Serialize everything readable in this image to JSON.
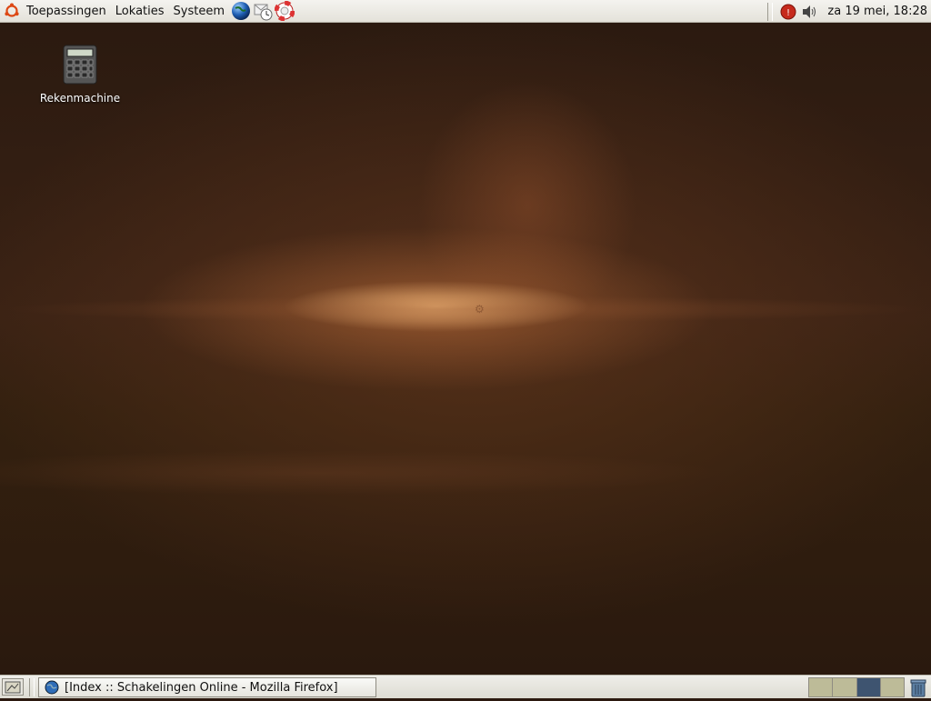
{
  "top_panel": {
    "menus": [
      {
        "label": "Toepassingen"
      },
      {
        "label": "Lokaties"
      },
      {
        "label": "Systeem"
      }
    ],
    "launchers": [
      "firefox-icon",
      "mail-clock-icon",
      "help-lifebuoy-icon"
    ],
    "tray": {
      "icons": [
        "update-notifier-icon",
        "volume-icon"
      ],
      "clock": "za 19 mei, 18:28"
    }
  },
  "desktop": {
    "icons": [
      {
        "label": "Rekenmachine",
        "icon": "calculator-icon"
      }
    ]
  },
  "bottom_panel": {
    "tasks": [
      {
        "label": "[Index :: Schakelingen Online - Mozilla Firefox]",
        "icon": "firefox-icon"
      }
    ],
    "workspaces": 4,
    "active_workspace": 3
  },
  "colors": {
    "panel": "#e9e7e0",
    "desktop_base": "#2c190f",
    "active_workspace": "#3e5470"
  }
}
